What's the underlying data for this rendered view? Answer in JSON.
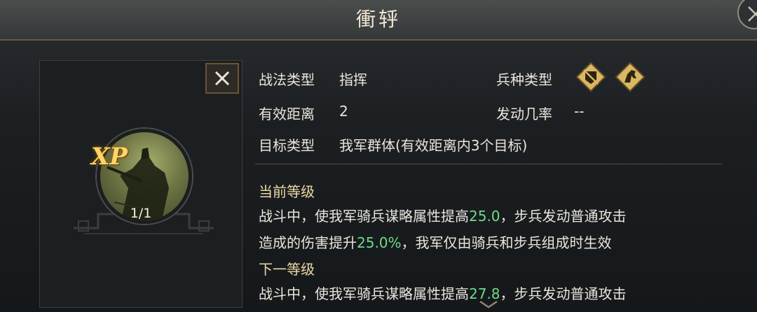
{
  "title": "衝轷",
  "level_badge": {
    "xp": "XP",
    "level": "1/1"
  },
  "stats": {
    "type_label": "战法类型",
    "type_value": "指挥",
    "range_label": "有效距离",
    "range_value": "2",
    "target_label": "目标类型",
    "target_value": "我军群体(有效距离内3个目标)",
    "troop_label": "兵种类型",
    "troop_icons": [
      "infantry-shield-icon",
      "cavalry-horse-icon"
    ],
    "rate_label": "发动几率",
    "rate_value": "--"
  },
  "current_level": {
    "title": "当前等级",
    "l1_a": "战斗中，使我军骑兵谋略属性提高",
    "l1_v": "25.0",
    "l1_b": "，步兵发动普通攻击",
    "l2_a": "造成的伤害提升",
    "l2_v": "25.0%",
    "l2_b": "，我军仅由骑兵和步兵组成时生效"
  },
  "next_level": {
    "title": "下一等级",
    "l1_a": "战斗中，使我军骑兵谋略属性提高",
    "l1_v": "27.8",
    "l1_b": "，步兵发动普通攻击"
  },
  "colors": {
    "highlight": "#6ddc86",
    "gold": "#ffd564",
    "section": "#ecd9a4"
  }
}
